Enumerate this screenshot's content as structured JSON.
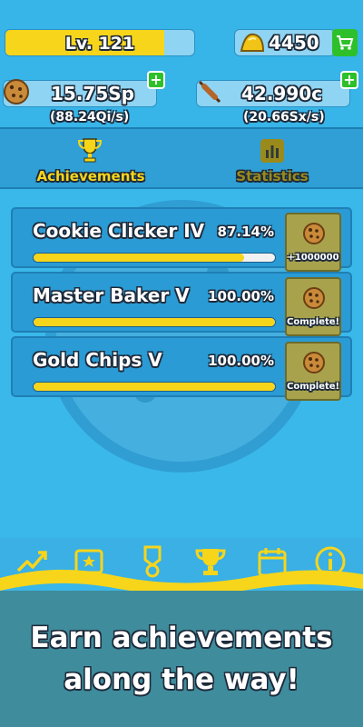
{
  "header": {
    "level_label": "Lv. 121",
    "level_progress": 0.84,
    "gold": "4450",
    "cookies_amount": "15.75Sp",
    "cookies_rate": "(88.24Qi/s)",
    "rolling_pin_amount": "42.990c",
    "rolling_pin_rate": "(20.66Sx/s)",
    "plus_label": "+"
  },
  "tabs": [
    {
      "label": "Achievements",
      "active": true,
      "icon": "trophy-icon"
    },
    {
      "label": "Statistics",
      "active": false,
      "icon": "bar-chart-icon"
    }
  ],
  "achievements": [
    {
      "title": "Cookie Clicker IV",
      "percent_label": "87.14%",
      "progress": 0.8714,
      "reward": "+1000000"
    },
    {
      "title": "Master Baker V",
      "percent_label": "100.00%",
      "progress": 1.0,
      "reward": "Complete!"
    },
    {
      "title": "Gold Chips V",
      "percent_label": "100.00%",
      "progress": 1.0,
      "reward": "Complete!"
    }
  ],
  "nav": [
    {
      "icon": "trend-icon"
    },
    {
      "icon": "star-ticket-icon"
    },
    {
      "icon": "medal-icon"
    },
    {
      "icon": "trophy-icon"
    },
    {
      "icon": "calendar-icon"
    },
    {
      "icon": "info-icon"
    }
  ],
  "caption": {
    "line1": "Earn achievements",
    "line2": "along the way!"
  },
  "colors": {
    "accent_yellow": "#f7d51b",
    "sky_blue": "#39b6ea",
    "green": "#2ec02a",
    "teal": "#3f8c9c"
  }
}
